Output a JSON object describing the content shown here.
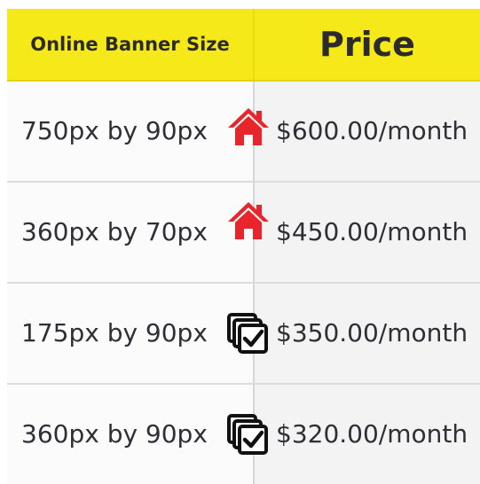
{
  "header": {
    "size_label": "Online Banner Size",
    "price_label": "Price"
  },
  "rows": [
    {
      "size": "750px by 90px",
      "price": "$600.00/month",
      "icon": "home-icon"
    },
    {
      "size": "360px by 70px",
      "price": "$450.00/month",
      "icon": "home-icon"
    },
    {
      "size": "175px by 90px",
      "price": "$350.00/month",
      "icon": "stacked-checkbox-icon"
    },
    {
      "size": "360px by 90px",
      "price": "$320.00/month",
      "icon": "stacked-checkbox-icon"
    }
  ],
  "colors": {
    "header_bg": "#f5e91a",
    "home_icon": "#e8252b",
    "text": "#2f2f36"
  }
}
